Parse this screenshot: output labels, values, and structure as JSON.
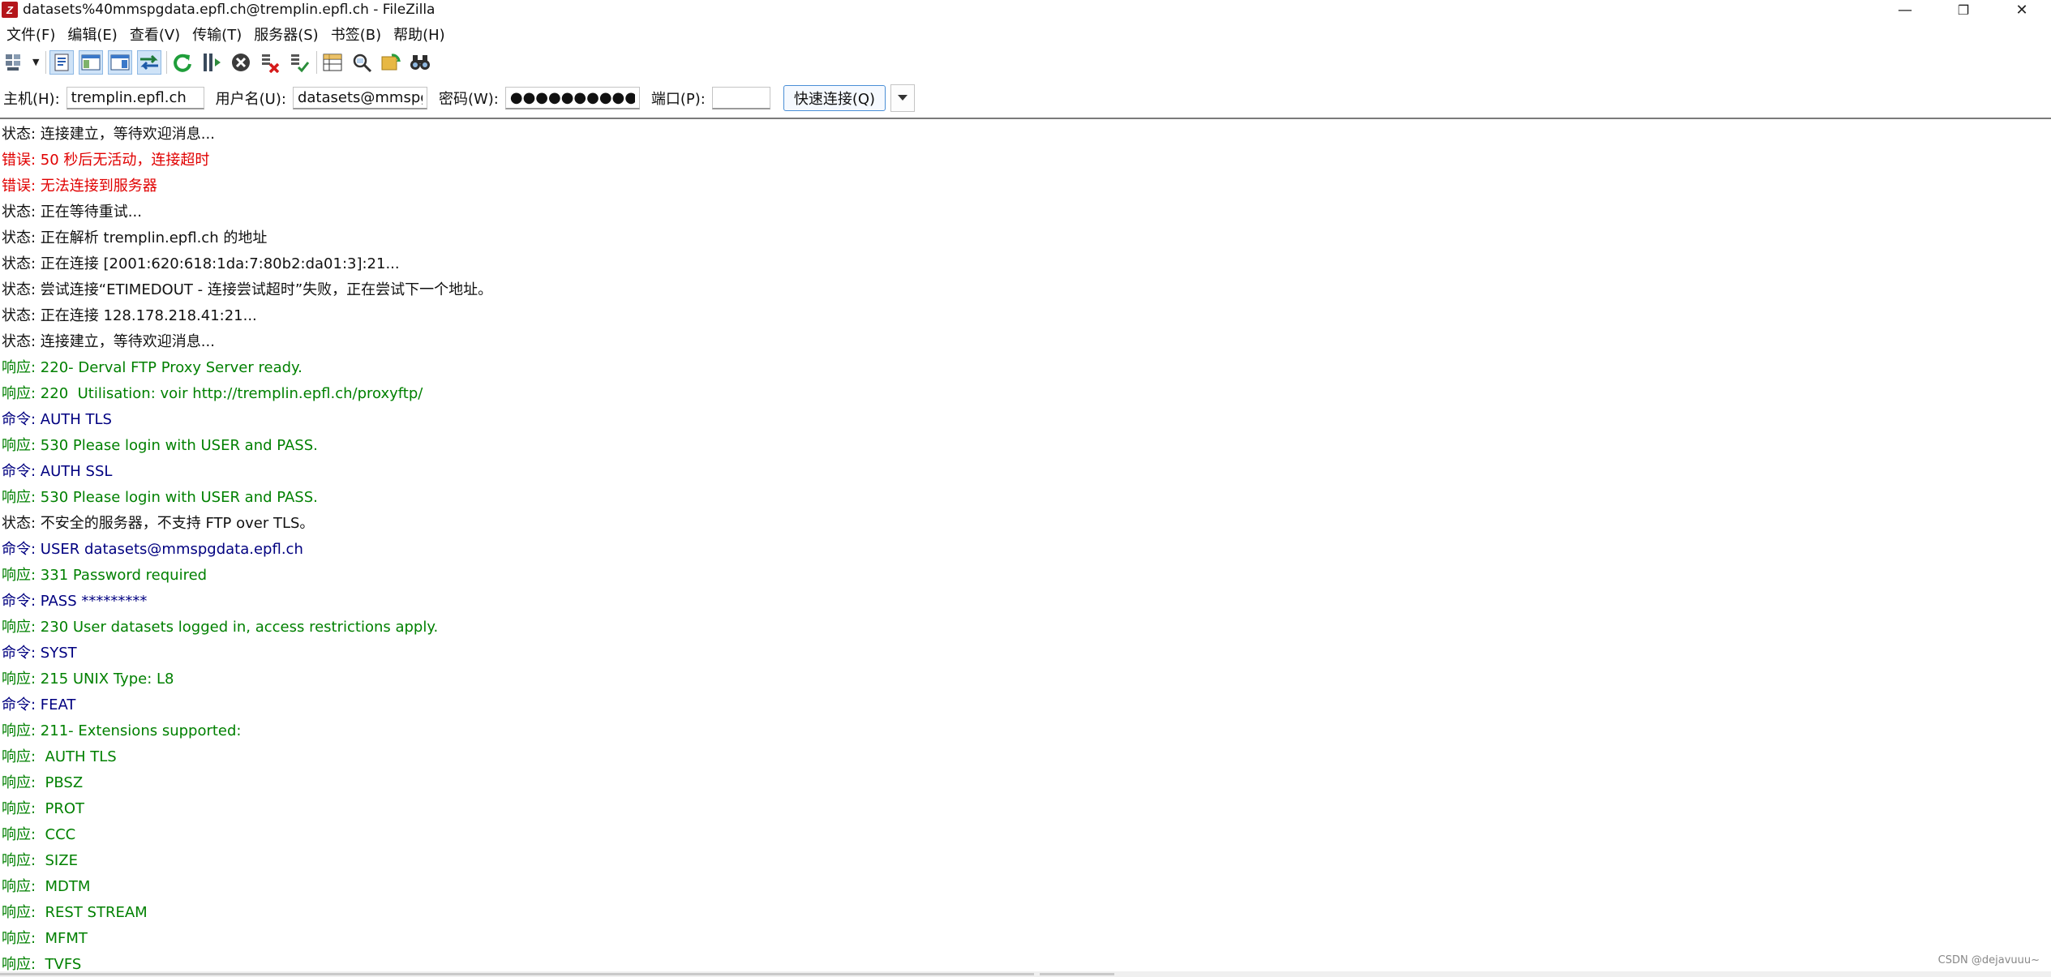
{
  "window": {
    "title": "datasets%40mmspgdata.epfl.ch@tremplin.epfl.ch - FileZilla",
    "app_icon_letter": "Z",
    "controls": {
      "minimize": "—",
      "restore": "❐",
      "close": "✕"
    }
  },
  "menu": [
    {
      "label": "文件(F)"
    },
    {
      "label": "编辑(E)"
    },
    {
      "label": "查看(V)"
    },
    {
      "label": "传输(T)"
    },
    {
      "label": "服务器(S)"
    },
    {
      "label": "书签(B)"
    },
    {
      "label": "帮助(H)"
    }
  ],
  "toolbar": [
    {
      "icon": "site-manager-icon"
    },
    {
      "icon": "toggle-message-log-icon"
    },
    {
      "icon": "toggle-local-tree-icon"
    },
    {
      "icon": "toggle-remote-tree-icon"
    },
    {
      "icon": "toggle-transfer-queue-icon"
    },
    {
      "icon": "refresh-icon"
    },
    {
      "icon": "process-queue-icon"
    },
    {
      "icon": "cancel-operation-icon"
    },
    {
      "icon": "disconnect-icon"
    },
    {
      "icon": "reconnect-icon"
    },
    {
      "icon": "directory-listing-filters-icon"
    },
    {
      "icon": "directory-comparison-icon"
    },
    {
      "icon": "synchronized-browsing-icon"
    },
    {
      "icon": "search-remote-files-icon"
    }
  ],
  "quickconnect": {
    "host_label": "主机(H):",
    "host_value": "tremplin.epfl.ch",
    "user_label": "用户名(U):",
    "user_value": "datasets@mmspg",
    "pass_label": "密码(W):",
    "pass_value": "●●●●●●●●●●",
    "port_label": "端口(P):",
    "port_value": "",
    "connect_label": "快速连接(Q)",
    "dropdown_icon": "chevron-down-icon"
  },
  "log": [
    {
      "type": "status",
      "text": "状态: 连接建立，等待欢迎消息..."
    },
    {
      "type": "error",
      "text": "错误: 50 秒后无活动，连接超时"
    },
    {
      "type": "error",
      "text": "错误: 无法连接到服务器"
    },
    {
      "type": "status",
      "text": "状态: 正在等待重试..."
    },
    {
      "type": "status",
      "text": "状态: 正在解析 tremplin.epfl.ch 的地址"
    },
    {
      "type": "status",
      "text": "状态: 正在连接 [2001:620:618:1da:7:80b2:da01:3]:21..."
    },
    {
      "type": "status",
      "text": "状态: 尝试连接“ETIMEDOUT - 连接尝试超时”失败，正在尝试下一个地址。"
    },
    {
      "type": "status",
      "text": "状态: 正在连接 128.178.218.41:21..."
    },
    {
      "type": "status",
      "text": "状态: 连接建立，等待欢迎消息..."
    },
    {
      "type": "resp",
      "text": "响应: 220- Derval FTP Proxy Server ready."
    },
    {
      "type": "resp",
      "text": "响应: 220  Utilisation: voir http://tremplin.epfl.ch/proxyftp/"
    },
    {
      "type": "cmd",
      "text": "命令: AUTH TLS"
    },
    {
      "type": "resp",
      "text": "响应: 530 Please login with USER and PASS."
    },
    {
      "type": "cmd",
      "text": "命令: AUTH SSL"
    },
    {
      "type": "resp",
      "text": "响应: 530 Please login with USER and PASS."
    },
    {
      "type": "status",
      "text": "状态: 不安全的服务器，不支持 FTP over TLS。"
    },
    {
      "type": "cmd",
      "text": "命令: USER datasets@mmspgdata.epfl.ch"
    },
    {
      "type": "resp",
      "text": "响应: 331 Password required"
    },
    {
      "type": "cmd",
      "text": "命令: PASS *********"
    },
    {
      "type": "resp",
      "text": "响应: 230 User datasets logged in, access restrictions apply."
    },
    {
      "type": "cmd",
      "text": "命令: SYST"
    },
    {
      "type": "resp",
      "text": "响应: 215 UNIX Type: L8"
    },
    {
      "type": "cmd",
      "text": "命令: FEAT"
    },
    {
      "type": "resp",
      "text": "响应: 211- Extensions supported:"
    },
    {
      "type": "resp",
      "text": "响应:  AUTH TLS"
    },
    {
      "type": "resp",
      "text": "响应:  PBSZ"
    },
    {
      "type": "resp",
      "text": "响应:  PROT"
    },
    {
      "type": "resp",
      "text": "响应:  CCC"
    },
    {
      "type": "resp",
      "text": "响应:  SIZE"
    },
    {
      "type": "resp",
      "text": "响应:  MDTM"
    },
    {
      "type": "resp",
      "text": "响应:  REST STREAM"
    },
    {
      "type": "resp",
      "text": "响应:  MFMT"
    },
    {
      "type": "resp",
      "text": "响应:  TVFS"
    }
  ],
  "colors": {
    "status": "#111111",
    "error": "#e00000",
    "resp": "#008000",
    "cmd": "#000080"
  },
  "watermark": "CSDN @dejavuuu~"
}
